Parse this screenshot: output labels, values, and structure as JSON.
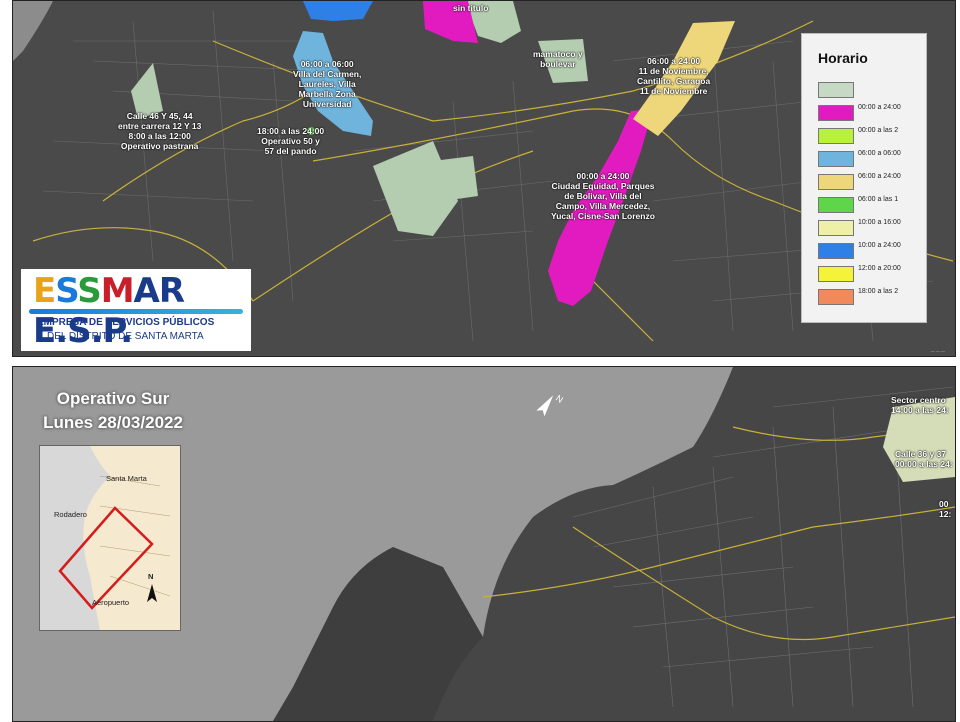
{
  "top_map": {
    "legend": {
      "title": "Horario",
      "items": [
        {
          "label": "",
          "color": "#c6d9c4"
        },
        {
          "label": "00:00 a 24:00",
          "color": "#e21bc0"
        },
        {
          "label": "00:00 a las 2",
          "color": "#b8f23c"
        },
        {
          "label": "06:00 a 06:00",
          "color": "#6fb4dc"
        },
        {
          "label": "06:00 a 24:00",
          "color": "#eed77a"
        },
        {
          "label": "06:00 a las 1",
          "color": "#5fd64a"
        },
        {
          "label": "10:00 a 16:00",
          "color": "#eef0a8"
        },
        {
          "label": "10:00 a 24:00",
          "color": "#2e7fe6"
        },
        {
          "label": "12:00 a 20:00",
          "color": "#f5f23a"
        },
        {
          "label": "18:00 a las 2",
          "color": "#f08a5a"
        }
      ]
    },
    "labels": {
      "sin_titulo": "sin titulo",
      "mamatoco": "mamatoco y\nboulevar",
      "once_nov": "06:00 a 24:00\n11 de Noviembre,\nCantilito, Garagoa\n11 de Noviembre",
      "villa_carmen": "06:00 a 06:00\nVilla del Carmen,\nLaureles, Villa\nMarbella Zona\nUniversidad",
      "calle46": "Calle 46 Y 45, 44\nentre carrera 12 Y 13\n8:00 a las 12:00\nOperativo pastrana",
      "operativo50": "18:00 a las 24:00\nOperativo 50 y\n57 del pando",
      "ciudad_equidad": "00:00 a 24:00\nCiudad Equidad, Parques\nde Bolivar, Villa del\nCampo, Villa Mercedez,\nYucal, Cisne-San Lorenzo"
    },
    "logo": {
      "name": "ESSMAR E.S.P.",
      "line1": "EMPRESA DE SERVICIOS PÚBLICOS",
      "line2": "DEL DISTRITO DE SANTA MARTA"
    }
  },
  "bottom_map": {
    "title_line1": "Operativo Sur",
    "title_line2": "Lunes 28/03/2022",
    "inset": {
      "santa_marta": "Santa Marta",
      "rodadero": "Rodadero",
      "aeropuerto": "Aeropuerto",
      "north": "N"
    },
    "labels": {
      "sector_centro": "Sector centro\n14:00 a las 24:",
      "calle36": "Calle 36 y 37\n00:00 a las 24:",
      "edge": "00\n12:"
    }
  }
}
